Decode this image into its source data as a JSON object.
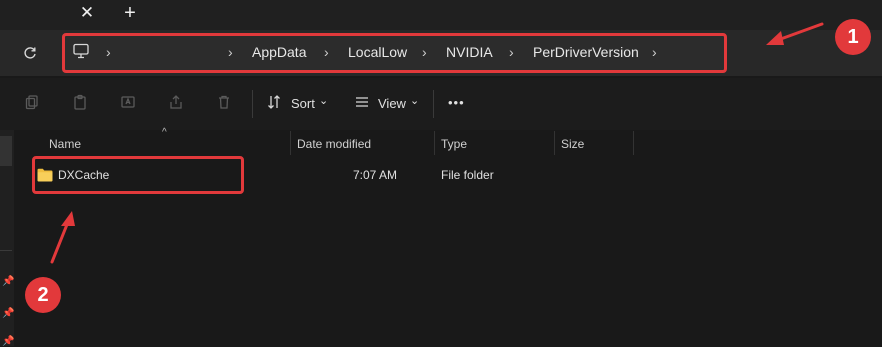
{
  "tab": {
    "close_icon": "close-icon",
    "new_tab": "+"
  },
  "address": {
    "chevron": "›",
    "crumbs": [
      "AppData",
      "LocalLow",
      "NVIDIA",
      "PerDriverVersion"
    ]
  },
  "toolbar": {
    "sort_label": "Sort",
    "view_label": "View",
    "more_label": "•••",
    "caret": "⌄"
  },
  "columns": {
    "name": "Name",
    "date": "Date modified",
    "type": "Type",
    "size": "Size"
  },
  "rows": [
    {
      "name": "DXCache",
      "date": "7:07 AM",
      "type": "File folder",
      "size": ""
    }
  ],
  "annotations": {
    "badge1": "1",
    "badge2": "2",
    "color": "#e2393b"
  }
}
